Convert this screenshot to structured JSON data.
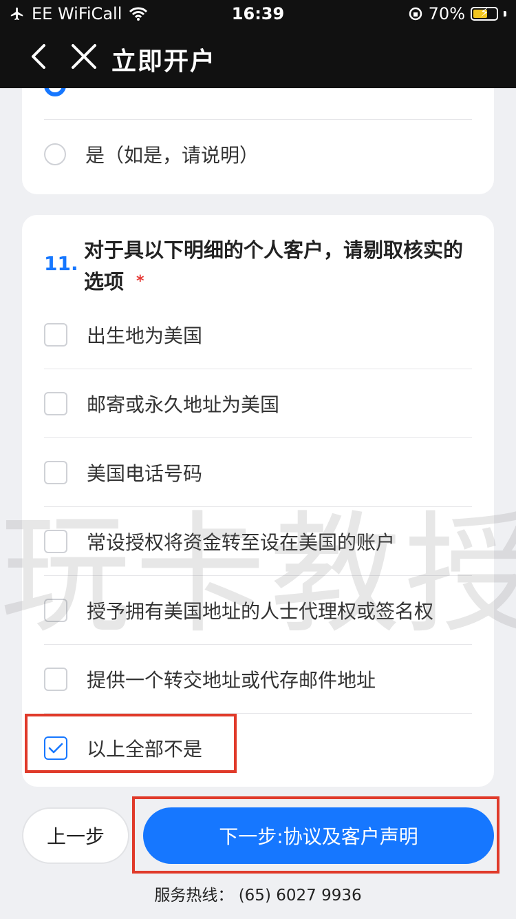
{
  "status_bar": {
    "carrier": "EE WiFiCall",
    "time": "16:39",
    "battery": "70%"
  },
  "nav": {
    "title": "立即开户"
  },
  "prev_question": {
    "options": [
      {
        "label": "",
        "checked": true
      },
      {
        "label": "是（如是，请说明）",
        "checked": false
      }
    ]
  },
  "question": {
    "number": "11.",
    "text": "对于具以下明细的个人客户，请剔取核实的选项",
    "required_mark": "*",
    "options": [
      {
        "label": "出生地为美国",
        "checked": false
      },
      {
        "label": "邮寄或永久地址为美国",
        "checked": false
      },
      {
        "label": "美国电话号码",
        "checked": false
      },
      {
        "label": "常设授权将资金转至设在美国的账户",
        "checked": false
      },
      {
        "label": "授予拥有美国地址的人士代理权或签名权",
        "checked": false
      },
      {
        "label": "提供一个转交地址或代存邮件地址",
        "checked": false
      },
      {
        "label": "以上全部不是",
        "checked": true
      }
    ]
  },
  "footer": {
    "prev_label": "上一步",
    "next_label": "下一步:协议及客户声明",
    "hotline": "服务热线：  (65) 6027 9936"
  },
  "watermark": "玩卡教授",
  "colors": {
    "accent": "#1677ff",
    "highlight": "#e03a2a",
    "required": "#e53935"
  }
}
